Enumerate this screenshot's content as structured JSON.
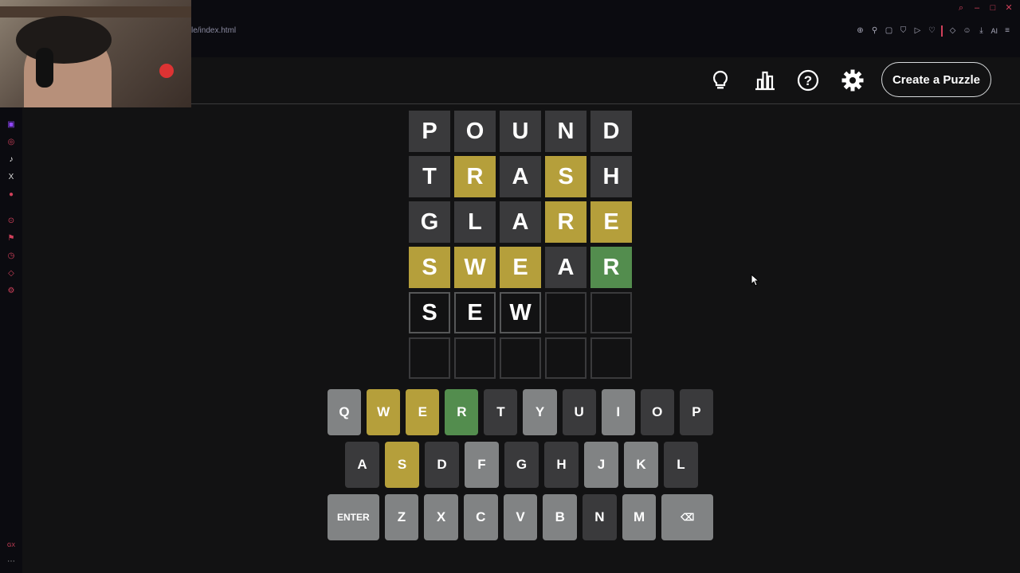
{
  "browser": {
    "url": "le/index.html",
    "ai_label": "AI"
  },
  "header": {
    "create_button": "Create a Puzzle",
    "icons": [
      "lightbulb-icon",
      "stats-icon",
      "help-icon",
      "settings-icon"
    ]
  },
  "colors": {
    "absent": "#3a3a3c",
    "present": "#b59f3b",
    "correct": "#538d4e",
    "unused": "#818384"
  },
  "board": {
    "rows": [
      [
        {
          "l": "P",
          "s": "absent"
        },
        {
          "l": "O",
          "s": "absent"
        },
        {
          "l": "U",
          "s": "absent"
        },
        {
          "l": "N",
          "s": "absent"
        },
        {
          "l": "D",
          "s": "absent"
        }
      ],
      [
        {
          "l": "T",
          "s": "absent"
        },
        {
          "l": "R",
          "s": "present"
        },
        {
          "l": "A",
          "s": "absent"
        },
        {
          "l": "S",
          "s": "present"
        },
        {
          "l": "H",
          "s": "absent"
        }
      ],
      [
        {
          "l": "G",
          "s": "absent"
        },
        {
          "l": "L",
          "s": "absent"
        },
        {
          "l": "A",
          "s": "absent"
        },
        {
          "l": "R",
          "s": "present"
        },
        {
          "l": "E",
          "s": "present"
        }
      ],
      [
        {
          "l": "S",
          "s": "present"
        },
        {
          "l": "W",
          "s": "present"
        },
        {
          "l": "E",
          "s": "present"
        },
        {
          "l": "A",
          "s": "absent"
        },
        {
          "l": "R",
          "s": "correct"
        }
      ],
      [
        {
          "l": "S",
          "s": "tbd"
        },
        {
          "l": "E",
          "s": "tbd"
        },
        {
          "l": "W",
          "s": "tbd"
        },
        {
          "l": "",
          "s": "empty"
        },
        {
          "l": "",
          "s": "empty"
        }
      ],
      [
        {
          "l": "",
          "s": "empty"
        },
        {
          "l": "",
          "s": "empty"
        },
        {
          "l": "",
          "s": "empty"
        },
        {
          "l": "",
          "s": "empty"
        },
        {
          "l": "",
          "s": "empty"
        }
      ]
    ]
  },
  "keyboard": {
    "rows": [
      [
        {
          "k": "Q",
          "s": "unused"
        },
        {
          "k": "W",
          "s": "present"
        },
        {
          "k": "E",
          "s": "present"
        },
        {
          "k": "R",
          "s": "correct"
        },
        {
          "k": "T",
          "s": "absent"
        },
        {
          "k": "Y",
          "s": "unused"
        },
        {
          "k": "U",
          "s": "absent"
        },
        {
          "k": "I",
          "s": "unused"
        },
        {
          "k": "O",
          "s": "absent"
        },
        {
          "k": "P",
          "s": "absent"
        }
      ],
      [
        {
          "k": "A",
          "s": "absent"
        },
        {
          "k": "S",
          "s": "present"
        },
        {
          "k": "D",
          "s": "absent"
        },
        {
          "k": "F",
          "s": "unused"
        },
        {
          "k": "G",
          "s": "absent"
        },
        {
          "k": "H",
          "s": "absent"
        },
        {
          "k": "J",
          "s": "unused"
        },
        {
          "k": "K",
          "s": "unused"
        },
        {
          "k": "L",
          "s": "absent"
        }
      ],
      [
        {
          "k": "ENTER",
          "s": "unused",
          "wide": true
        },
        {
          "k": "Z",
          "s": "unused"
        },
        {
          "k": "X",
          "s": "unused"
        },
        {
          "k": "C",
          "s": "unused"
        },
        {
          "k": "V",
          "s": "unused"
        },
        {
          "k": "B",
          "s": "unused"
        },
        {
          "k": "N",
          "s": "absent"
        },
        {
          "k": "M",
          "s": "unused"
        },
        {
          "k": "⌫",
          "s": "unused",
          "wide": true
        }
      ]
    ]
  }
}
